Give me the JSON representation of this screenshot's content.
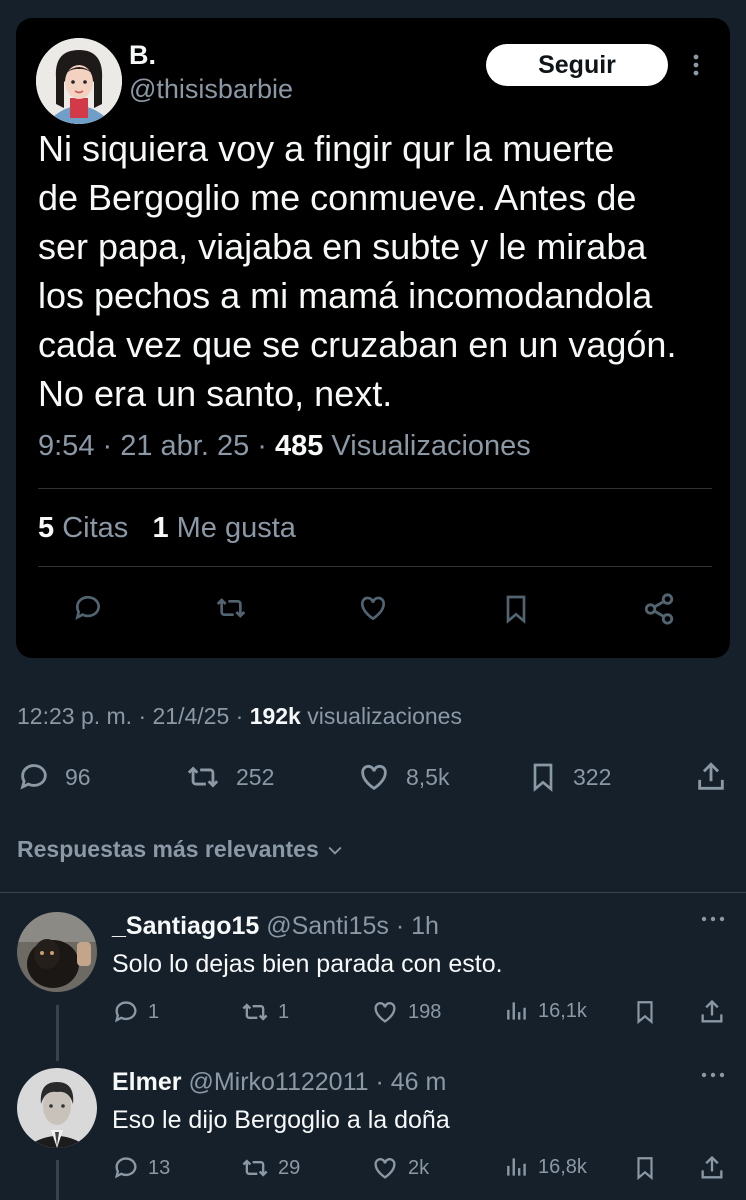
{
  "embedded_tweet": {
    "author_name": "B.",
    "author_handle": "@thisisbarbie",
    "follow_label": "Seguir",
    "text": "Ni siquiera voy a fingir qur la muerte\nde Bergoglio me conmueve. Antes de\nser papa, viajaba en subte y le miraba\nlos pechos a mi mamá incomodandola\ncada vez que se cruzaban en un vagón.\nNo era un santo, next.",
    "time_date": "9:54 · 21 abr. 25 · ",
    "views_count": "485",
    "views_label": " Visualizaciones",
    "quotes_count": "5",
    "quotes_label": " Citas",
    "likes_count": "1",
    "likes_label": " Me gusta",
    "action_icons": [
      "reply-icon",
      "retweet-icon",
      "like-icon",
      "bookmark-icon",
      "share-icon"
    ]
  },
  "post": {
    "time_date": "12:23 p. m. · 21/4/25 · ",
    "views_count": "192k",
    "views_label": " visualizaciones",
    "actions": {
      "replies": "96",
      "reposts": "252",
      "likes": "8,5k",
      "bookmarks": "322"
    }
  },
  "sort": {
    "label": "Respuestas más relevantes"
  },
  "replies": [
    {
      "name": "_Santiago15",
      "handle": "@Santi15s",
      "time": "· 1h",
      "text": "Solo lo dejas bien parada con esto.",
      "replies": "1",
      "reposts": "1",
      "likes": "198",
      "views": "16,1k"
    },
    {
      "name": "Elmer",
      "handle": "@Mirko1122011",
      "time": "· 46 m",
      "text": "Eso le dijo Bergoglio a la doña",
      "replies": "13",
      "reposts": "29",
      "likes": "2k",
      "views": "16,8k"
    }
  ],
  "colors": {
    "background": "#15202b",
    "card_background": "#000000",
    "text_primary": "#f7f9f9",
    "text_secondary": "#8b98a5",
    "divider": "#38444d"
  }
}
